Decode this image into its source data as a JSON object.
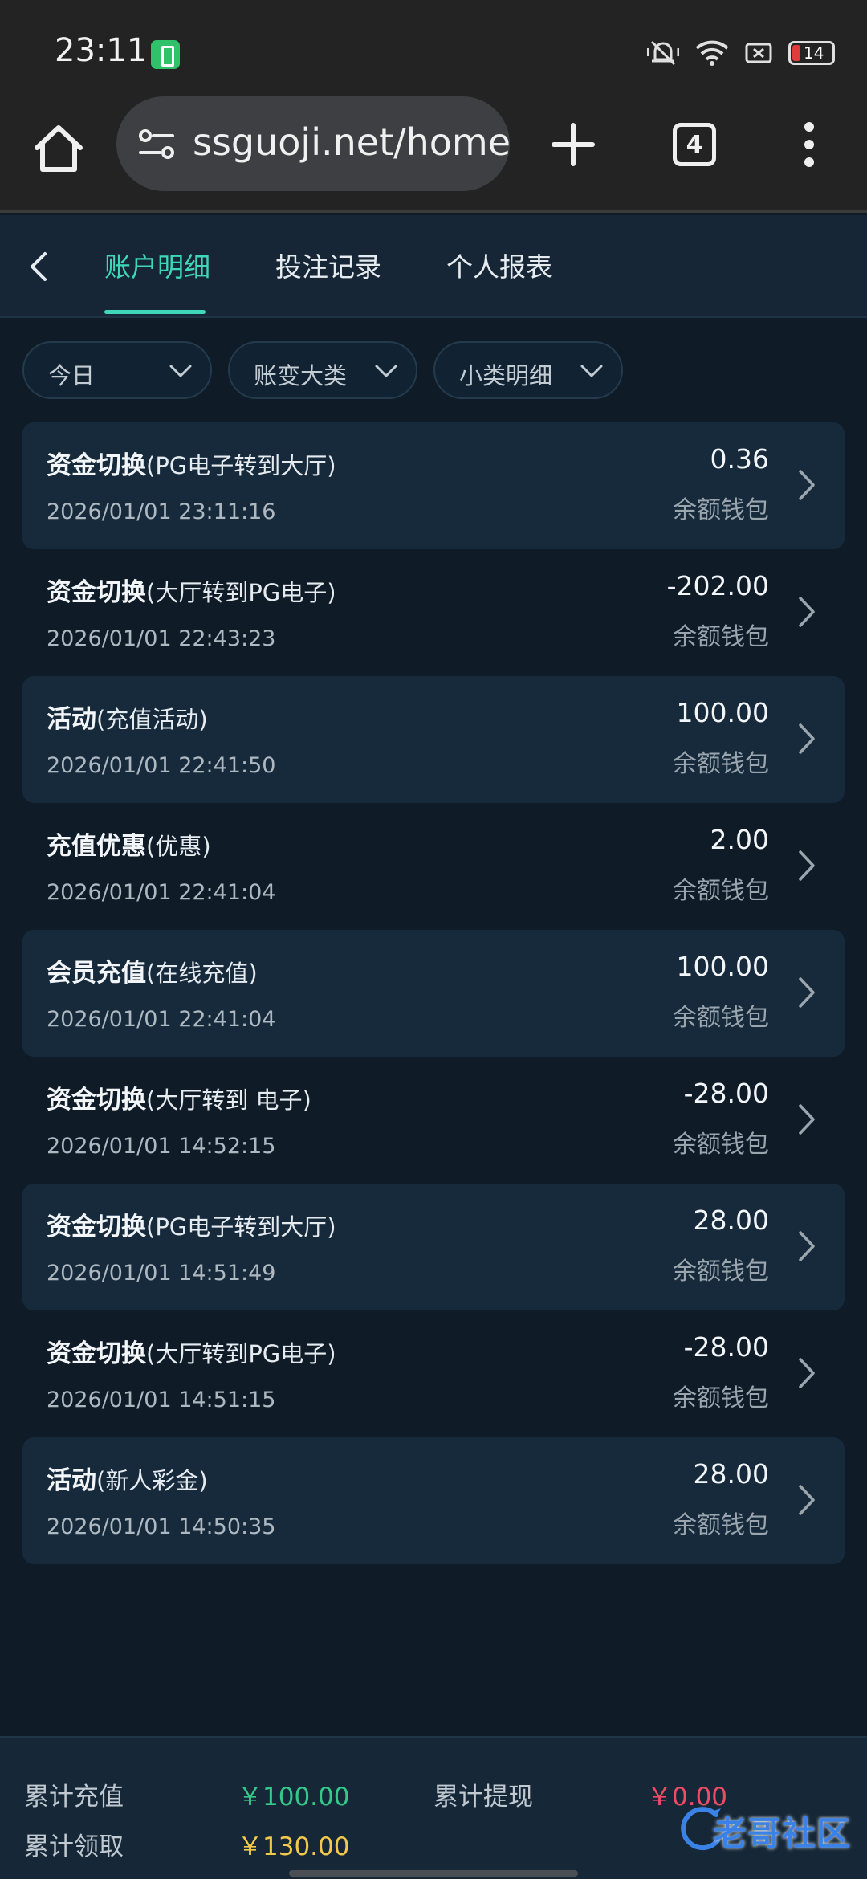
{
  "status_bar": {
    "time": "23:11",
    "battery": "14"
  },
  "browser": {
    "url": "ssguoji.net/home",
    "tab_count": "4"
  },
  "nav": {
    "tabs": [
      {
        "label": "账户明细",
        "active": true
      },
      {
        "label": "投注记录",
        "active": false
      },
      {
        "label": "个人报表",
        "active": false
      }
    ]
  },
  "filters": {
    "date": "今日",
    "category": "账变大类",
    "subcategory": "小类明细"
  },
  "records": [
    {
      "type": "资金切换",
      "sub": "(PG电子转到大厅)",
      "time": "2026/01/01 23:11:16",
      "amount": "0.36",
      "wallet": "余额钱包"
    },
    {
      "type": "资金切换",
      "sub": "(大厅转到PG电子)",
      "time": "2026/01/01 22:43:23",
      "amount": "-202.00",
      "wallet": "余额钱包"
    },
    {
      "type": "活动",
      "sub": "(充值活动)",
      "time": "2026/01/01 22:41:50",
      "amount": "100.00",
      "wallet": "余额钱包"
    },
    {
      "type": "充值优惠",
      "sub": "(优惠)",
      "time": "2026/01/01 22:41:04",
      "amount": "2.00",
      "wallet": "余额钱包"
    },
    {
      "type": "会员充值",
      "sub": "(在线充值)",
      "time": "2026/01/01 22:41:04",
      "amount": "100.00",
      "wallet": "余额钱包"
    },
    {
      "type": "资金切换",
      "sub": "(大厅转到 电子)",
      "time": "2026/01/01 14:52:15",
      "amount": "-28.00",
      "wallet": "余额钱包"
    },
    {
      "type": "资金切换",
      "sub": "(PG电子转到大厅)",
      "time": "2026/01/01 14:51:49",
      "amount": "28.00",
      "wallet": "余额钱包"
    },
    {
      "type": "资金切换",
      "sub": "(大厅转到PG电子)",
      "time": "2026/01/01 14:51:15",
      "amount": "-28.00",
      "wallet": "余额钱包"
    },
    {
      "type": "活动",
      "sub": "(新人彩金)",
      "time": "2026/01/01 14:50:35",
      "amount": "28.00",
      "wallet": "余额钱包"
    }
  ],
  "summary": {
    "recharge_label": "累计充值",
    "recharge_value": "￥100.00",
    "withdraw_label": "累计提现",
    "withdraw_value": "￥0.00",
    "claim_label": "累计领取",
    "claim_value": "￥130.00"
  },
  "watermark": {
    "text": "老哥社区"
  },
  "colors": {
    "accent": "#3fd7b9",
    "background": "#0f1c28",
    "card": "#162a3b",
    "positive": "#35c88b",
    "negative": "#ef4a66",
    "highlight": "#f2c94c"
  }
}
